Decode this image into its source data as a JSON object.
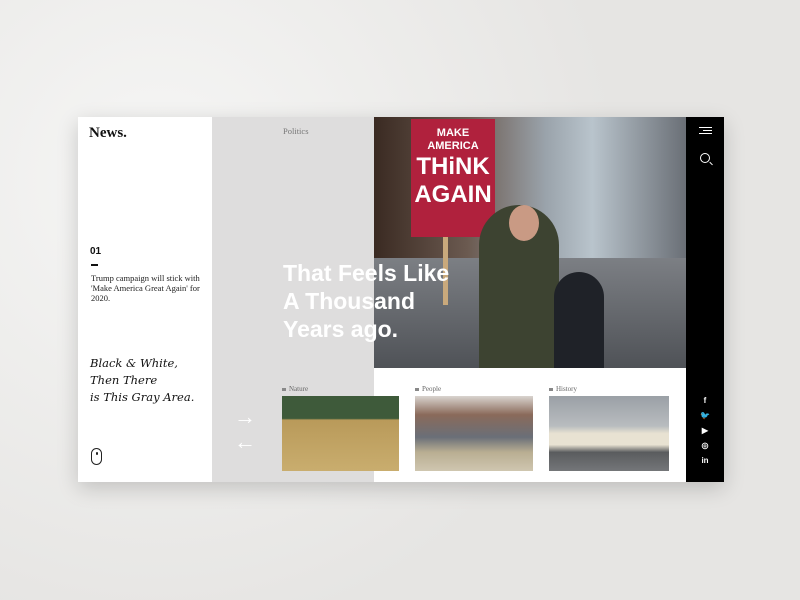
{
  "brand": "News.",
  "story": {
    "number": "01",
    "description": "Trump campaign will stick with 'Make America Great Again' for 2020.",
    "tagline": [
      "Black & White,",
      "Then There",
      "is This Gray Area."
    ]
  },
  "category": "Politics",
  "headline": [
    "That Feels Like",
    "A Thousand",
    "Years ago."
  ],
  "photo_sign": {
    "top": "MAKE AMERICA",
    "big": "THiNK AGAIN"
  },
  "thumbnails": [
    {
      "label": "Nature"
    },
    {
      "label": "People"
    },
    {
      "label": "History"
    }
  ],
  "social": {
    "facebook": "f",
    "twitter": "🐦",
    "youtube": "▶",
    "instagram": "◎",
    "linkedin": "in"
  },
  "nav": {
    "next": "→",
    "prev": "←"
  }
}
